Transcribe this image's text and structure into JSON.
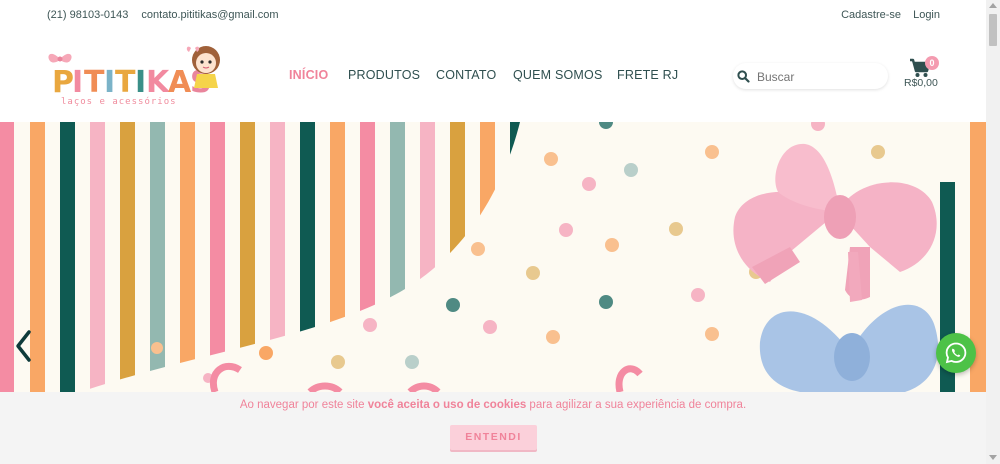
{
  "topbar": {
    "phone": "(21) 98103-0143",
    "email": "contato.pititikas@gmail.com",
    "register": "Cadastre-se",
    "login": "Login"
  },
  "logo": {
    "brand": "PITITIKAS",
    "tagline": "laços e acessórios"
  },
  "nav": {
    "items": [
      "INÍCIO",
      "PRODUTOS",
      "CONTATO",
      "QUEM SOMOS",
      "FRETE RJ"
    ],
    "active_index": 0
  },
  "search": {
    "placeholder": "Buscar"
  },
  "cart": {
    "count": "0",
    "total": "R$0,00"
  },
  "cookie": {
    "text_before": "Ao navegar por este site ",
    "text_bold": "você aceita o uso de cookies",
    "text_after": " para agilizar a sua experiência de compra.",
    "button": "ENTENDI"
  },
  "colors": {
    "accent_pink": "#f0839a",
    "text_dark": "#2f4f4f",
    "whatsapp_green": "#4dc247",
    "stripe_colors": [
      "#f48ca3",
      "#f9a765",
      "#0f5a52",
      "#f6b4c4",
      "#d9a13f",
      "#93b8b0"
    ]
  },
  "icons": {
    "search": "search-icon",
    "cart": "cart-icon",
    "prev": "chevron-left-icon",
    "whatsapp": "whatsapp-icon"
  }
}
